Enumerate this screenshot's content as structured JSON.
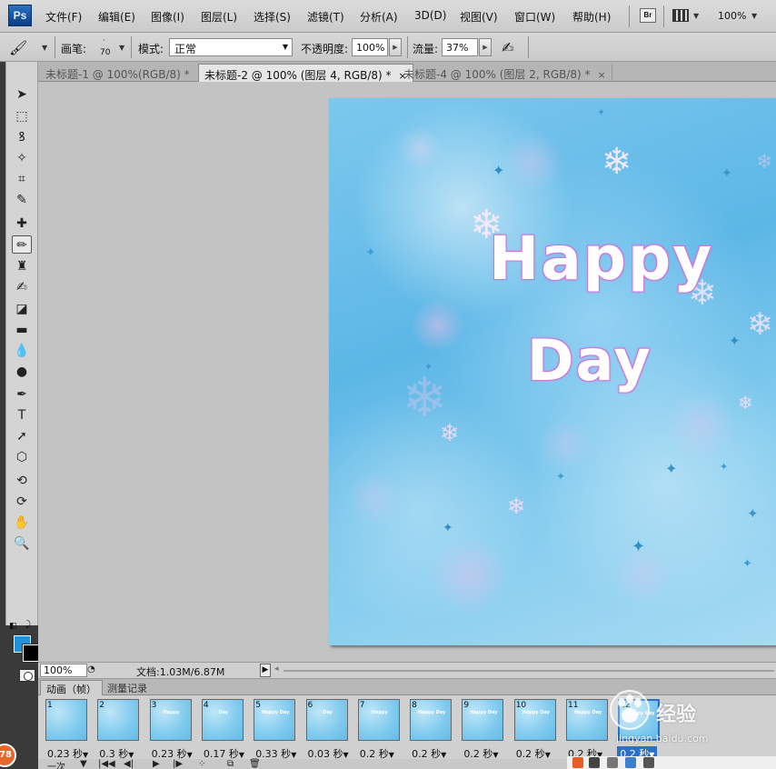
{
  "app": {
    "logo": "Ps",
    "zoom": "100%",
    "br_label": "Br"
  },
  "menu": [
    {
      "label": "文件(F)"
    },
    {
      "label": "编辑(E)"
    },
    {
      "label": "图像(I)"
    },
    {
      "label": "图层(L)"
    },
    {
      "label": "选择(S)"
    },
    {
      "label": "滤镜(T)"
    },
    {
      "label": "分析(A)"
    },
    {
      "label": "3D(D)"
    },
    {
      "label": "视图(V)"
    },
    {
      "label": "窗口(W)"
    },
    {
      "label": "帮助(H)"
    }
  ],
  "options": {
    "brush_label": "画笔:",
    "brush_size": "70",
    "mode_label": "模式:",
    "mode_value": "正常",
    "opacity_label": "不透明度:",
    "opacity_value": "100%",
    "flow_label": "流量:",
    "flow_value": "37%"
  },
  "tabs": [
    {
      "label": "未标题-1 @ 100%(RGB/8) *",
      "close": "×"
    },
    {
      "label": "未标题-2 @ 100% (图层 4, RGB/8) *",
      "close": "×"
    },
    {
      "label": "未标题-4 @ 100% (图层 2, RGB/8) *",
      "close": "×"
    }
  ],
  "tools": [
    {
      "name": "move-tool-icon",
      "glyph": "➤"
    },
    {
      "name": "marquee-tool-icon",
      "glyph": "⬚"
    },
    {
      "name": "lasso-tool-icon",
      "glyph": "ꝸ"
    },
    {
      "name": "magic-wand-tool-icon",
      "glyph": "✧"
    },
    {
      "name": "crop-tool-icon",
      "glyph": "⌗"
    },
    {
      "name": "eyedropper-tool-icon",
      "glyph": "✎"
    },
    {
      "name": "healing-brush-tool-icon",
      "glyph": "✚"
    },
    {
      "name": "brush-tool-icon",
      "glyph": "✏"
    },
    {
      "name": "clone-stamp-tool-icon",
      "glyph": "♜"
    },
    {
      "name": "history-brush-tool-icon",
      "glyph": "✍"
    },
    {
      "name": "eraser-tool-icon",
      "glyph": "◪"
    },
    {
      "name": "gradient-tool-icon",
      "glyph": "▬"
    },
    {
      "name": "blur-tool-icon",
      "glyph": "💧"
    },
    {
      "name": "dodge-tool-icon",
      "glyph": "●"
    },
    {
      "name": "pen-tool-icon",
      "glyph": "✒"
    },
    {
      "name": "type-tool-icon",
      "glyph": "T"
    },
    {
      "name": "path-selection-tool-icon",
      "glyph": "➚"
    },
    {
      "name": "shape-tool-icon",
      "glyph": "⬡"
    },
    {
      "name": "3d-rotate-tool-icon",
      "glyph": "⟲"
    },
    {
      "name": "3d-orbit-tool-icon",
      "glyph": "⟳"
    },
    {
      "name": "hand-tool-icon",
      "glyph": "✋"
    },
    {
      "name": "zoom-tool-icon",
      "glyph": "🔍"
    }
  ],
  "colors": {
    "foreground": "#2092d9",
    "background": "#000000"
  },
  "canvas": {
    "text_line1": "Happy",
    "text_line2": "Day"
  },
  "status": {
    "zoom": "100%",
    "doc": "文档:1.03M/6.87M"
  },
  "anim_tabs": [
    {
      "label": "动画（帧）"
    },
    {
      "label": "测量记录"
    }
  ],
  "frames": [
    {
      "num": "1",
      "delay": "0.23 秒",
      "text": ""
    },
    {
      "num": "2",
      "delay": "0.3 秒",
      "text": ""
    },
    {
      "num": "3",
      "delay": "0.23 秒",
      "text": "Happy"
    },
    {
      "num": "4",
      "delay": "0.17 秒",
      "text": "Day"
    },
    {
      "num": "5",
      "delay": "0.33 秒",
      "text": "Happy Day"
    },
    {
      "num": "6",
      "delay": "0.03 秒",
      "text": "Day"
    },
    {
      "num": "7",
      "delay": "0.2 秒",
      "text": "Happy"
    },
    {
      "num": "8",
      "delay": "0.2 秒",
      "text": "Happy Day"
    },
    {
      "num": "9",
      "delay": "0.2 秒",
      "text": "Happy Day"
    },
    {
      "num": "10",
      "delay": "0.2 秒",
      "text": "Happy Day"
    },
    {
      "num": "11",
      "delay": "0.2 秒",
      "text": "Happy Day"
    },
    {
      "num": "12",
      "delay": "0.2 秒",
      "text": "Happy Day"
    }
  ],
  "anim_controls": {
    "loop": "一次"
  },
  "watermark": {
    "text": "经验",
    "url": "jingyan.baidu.com"
  },
  "badge": "78"
}
